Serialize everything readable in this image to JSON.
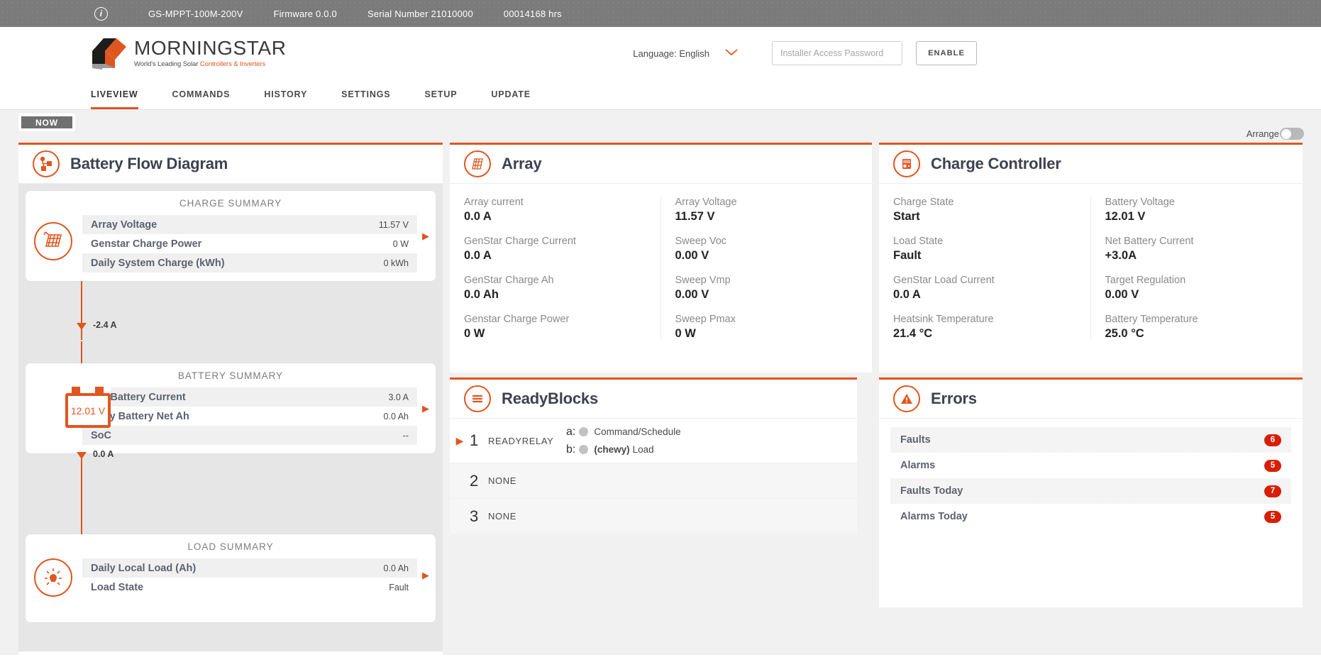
{
  "infobar": {
    "info_icon": "info-icon",
    "model": "GS-MPPT-100M-200V",
    "firmware": "Firmware 0.0.0",
    "serial": "Serial Number 21010000",
    "hours": "00014168 hrs"
  },
  "brand": {
    "name": "MORNINGSTAR",
    "tagline_1": "World's Leading Solar ",
    "tagline_accent": "Controllers & Inverters",
    "accent_color": "#e0561f"
  },
  "header": {
    "language_label": "Language: English",
    "chevron_icon": "chevron-down-icon",
    "password_placeholder": "Installer Access Password",
    "password_value": "",
    "enable_label": "ENABLE"
  },
  "nav": {
    "tabs": [
      {
        "label": "LIVEVIEW",
        "active": true
      },
      {
        "label": "COMMANDS",
        "active": false
      },
      {
        "label": "HISTORY",
        "active": false
      },
      {
        "label": "SETTINGS",
        "active": false
      },
      {
        "label": "SETUP",
        "active": false
      },
      {
        "label": "UPDATE",
        "active": false
      }
    ]
  },
  "subbar": {
    "now_label": "NOW",
    "arrange_label": "Arrange",
    "arrange_on": false
  },
  "battery_flow": {
    "title": "Battery Flow Diagram",
    "icon": "flow-diagram-icon",
    "charge": {
      "heading": "CHARGE SUMMARY",
      "node_icon": "solar-panel-icon",
      "rows": [
        {
          "key": "Array Voltage",
          "value": "11.57 V"
        },
        {
          "key": "Genstar Charge Power",
          "value": "0 W"
        },
        {
          "key": "Daily System Charge (kWh)",
          "value": "0 kWh"
        }
      ]
    },
    "flow_1": "-2.4 A",
    "battery": {
      "heading": "BATTERY SUMMARY",
      "node_icon": "battery-icon",
      "node_value": "12.01 V",
      "rows": [
        {
          "key": "Net Battery Current",
          "value": "3.0 A"
        },
        {
          "key": "Daily Battery Net Ah",
          "value": "0.0 Ah"
        },
        {
          "key": "SoC",
          "value": "--"
        }
      ]
    },
    "flow_2": "0.0 A",
    "load": {
      "heading": "LOAD SUMMARY",
      "node_icon": "light-bulb-icon",
      "rows": [
        {
          "key": "Daily Local Load (Ah)",
          "value": "0.0 Ah"
        },
        {
          "key": "Load State",
          "value": "Fault"
        }
      ]
    }
  },
  "array": {
    "title": "Array",
    "icon": "solar-panel-icon",
    "left": [
      {
        "label": "Array current",
        "value": "0.0 A"
      },
      {
        "label": "GenStar Charge Current",
        "value": "0.0 A"
      },
      {
        "label": "GenStar Charge Ah",
        "value": "0.0 Ah"
      },
      {
        "label": "Genstar Charge Power",
        "value": "0 W"
      }
    ],
    "right": [
      {
        "label": "Array Voltage",
        "value": "11.57 V"
      },
      {
        "label": "Sweep Voc",
        "value": "0.00 V"
      },
      {
        "label": "Sweep Vmp",
        "value": "0.00 V"
      },
      {
        "label": "Sweep Pmax",
        "value": "0 W"
      }
    ]
  },
  "readyblocks": {
    "title": "ReadyBlocks",
    "icon": "hamburger-list-icon",
    "rows": [
      {
        "caret": "▶",
        "num": "1",
        "name": "READYRELAY",
        "subs": [
          {
            "key": "a:",
            "bold": "",
            "text": "Command/Schedule"
          },
          {
            "key": "b:",
            "bold": "(chewy)",
            "text": "Load"
          }
        ]
      },
      {
        "caret": "",
        "num": "2",
        "name": "NONE",
        "subs": []
      },
      {
        "caret": "",
        "num": "3",
        "name": "NONE",
        "subs": []
      }
    ]
  },
  "charge_controller": {
    "title": "Charge Controller",
    "icon": "charge-controller-icon",
    "left": [
      {
        "label": "Charge State",
        "value": "Start"
      },
      {
        "label": "Load State",
        "value": "Fault"
      },
      {
        "label": "GenStar Load Current",
        "value": "0.0 A"
      },
      {
        "label": "Heatsink Temperature",
        "value": "21.4 °C"
      }
    ],
    "right": [
      {
        "label": "Battery Voltage",
        "value": "12.01 V"
      },
      {
        "label": "Net Battery Current",
        "value": "+3.0A"
      },
      {
        "label": "Target Regulation",
        "value": "0.00 V"
      },
      {
        "label": "Battery Temperature",
        "value": "25.0 °C"
      }
    ]
  },
  "errors": {
    "title": "Errors",
    "icon": "warning-triangle-icon",
    "badge_color": "#d81e05",
    "rows": [
      {
        "label": "Faults",
        "count": "6"
      },
      {
        "label": "Alarms",
        "count": "5"
      },
      {
        "label": "Faults Today",
        "count": "7"
      },
      {
        "label": "Alarms Today",
        "count": "5"
      }
    ]
  }
}
